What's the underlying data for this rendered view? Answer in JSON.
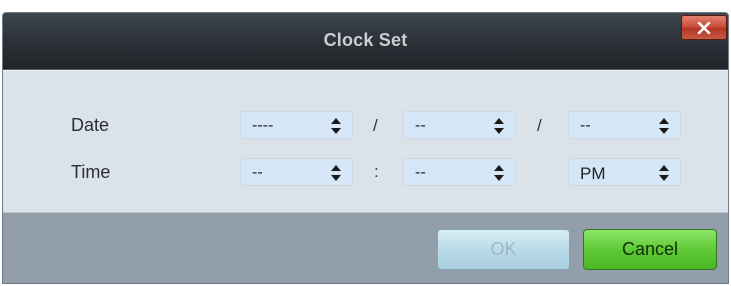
{
  "dialog": {
    "title": "Clock Set",
    "close_label": "x"
  },
  "date_row": {
    "label": "Date",
    "year": "----",
    "sep1": "/",
    "month": "--",
    "sep2": "/",
    "day": "--"
  },
  "time_row": {
    "label": "Time",
    "hour": "--",
    "sep": ":",
    "minute": "--",
    "ampm": "PM"
  },
  "buttons": {
    "ok_label": "OK",
    "cancel_label": "Cancel"
  },
  "colors": {
    "titlebar": "#2c3238",
    "content_bg": "#dbe3ea",
    "footer_bg": "#929eaa",
    "spin_bg": "#d5e7f6",
    "close_red": "#c9503d",
    "cancel_green": "#5fca35"
  },
  "icons": {
    "close": "close-icon",
    "spin_arrows": "up-down-arrows-icon"
  }
}
